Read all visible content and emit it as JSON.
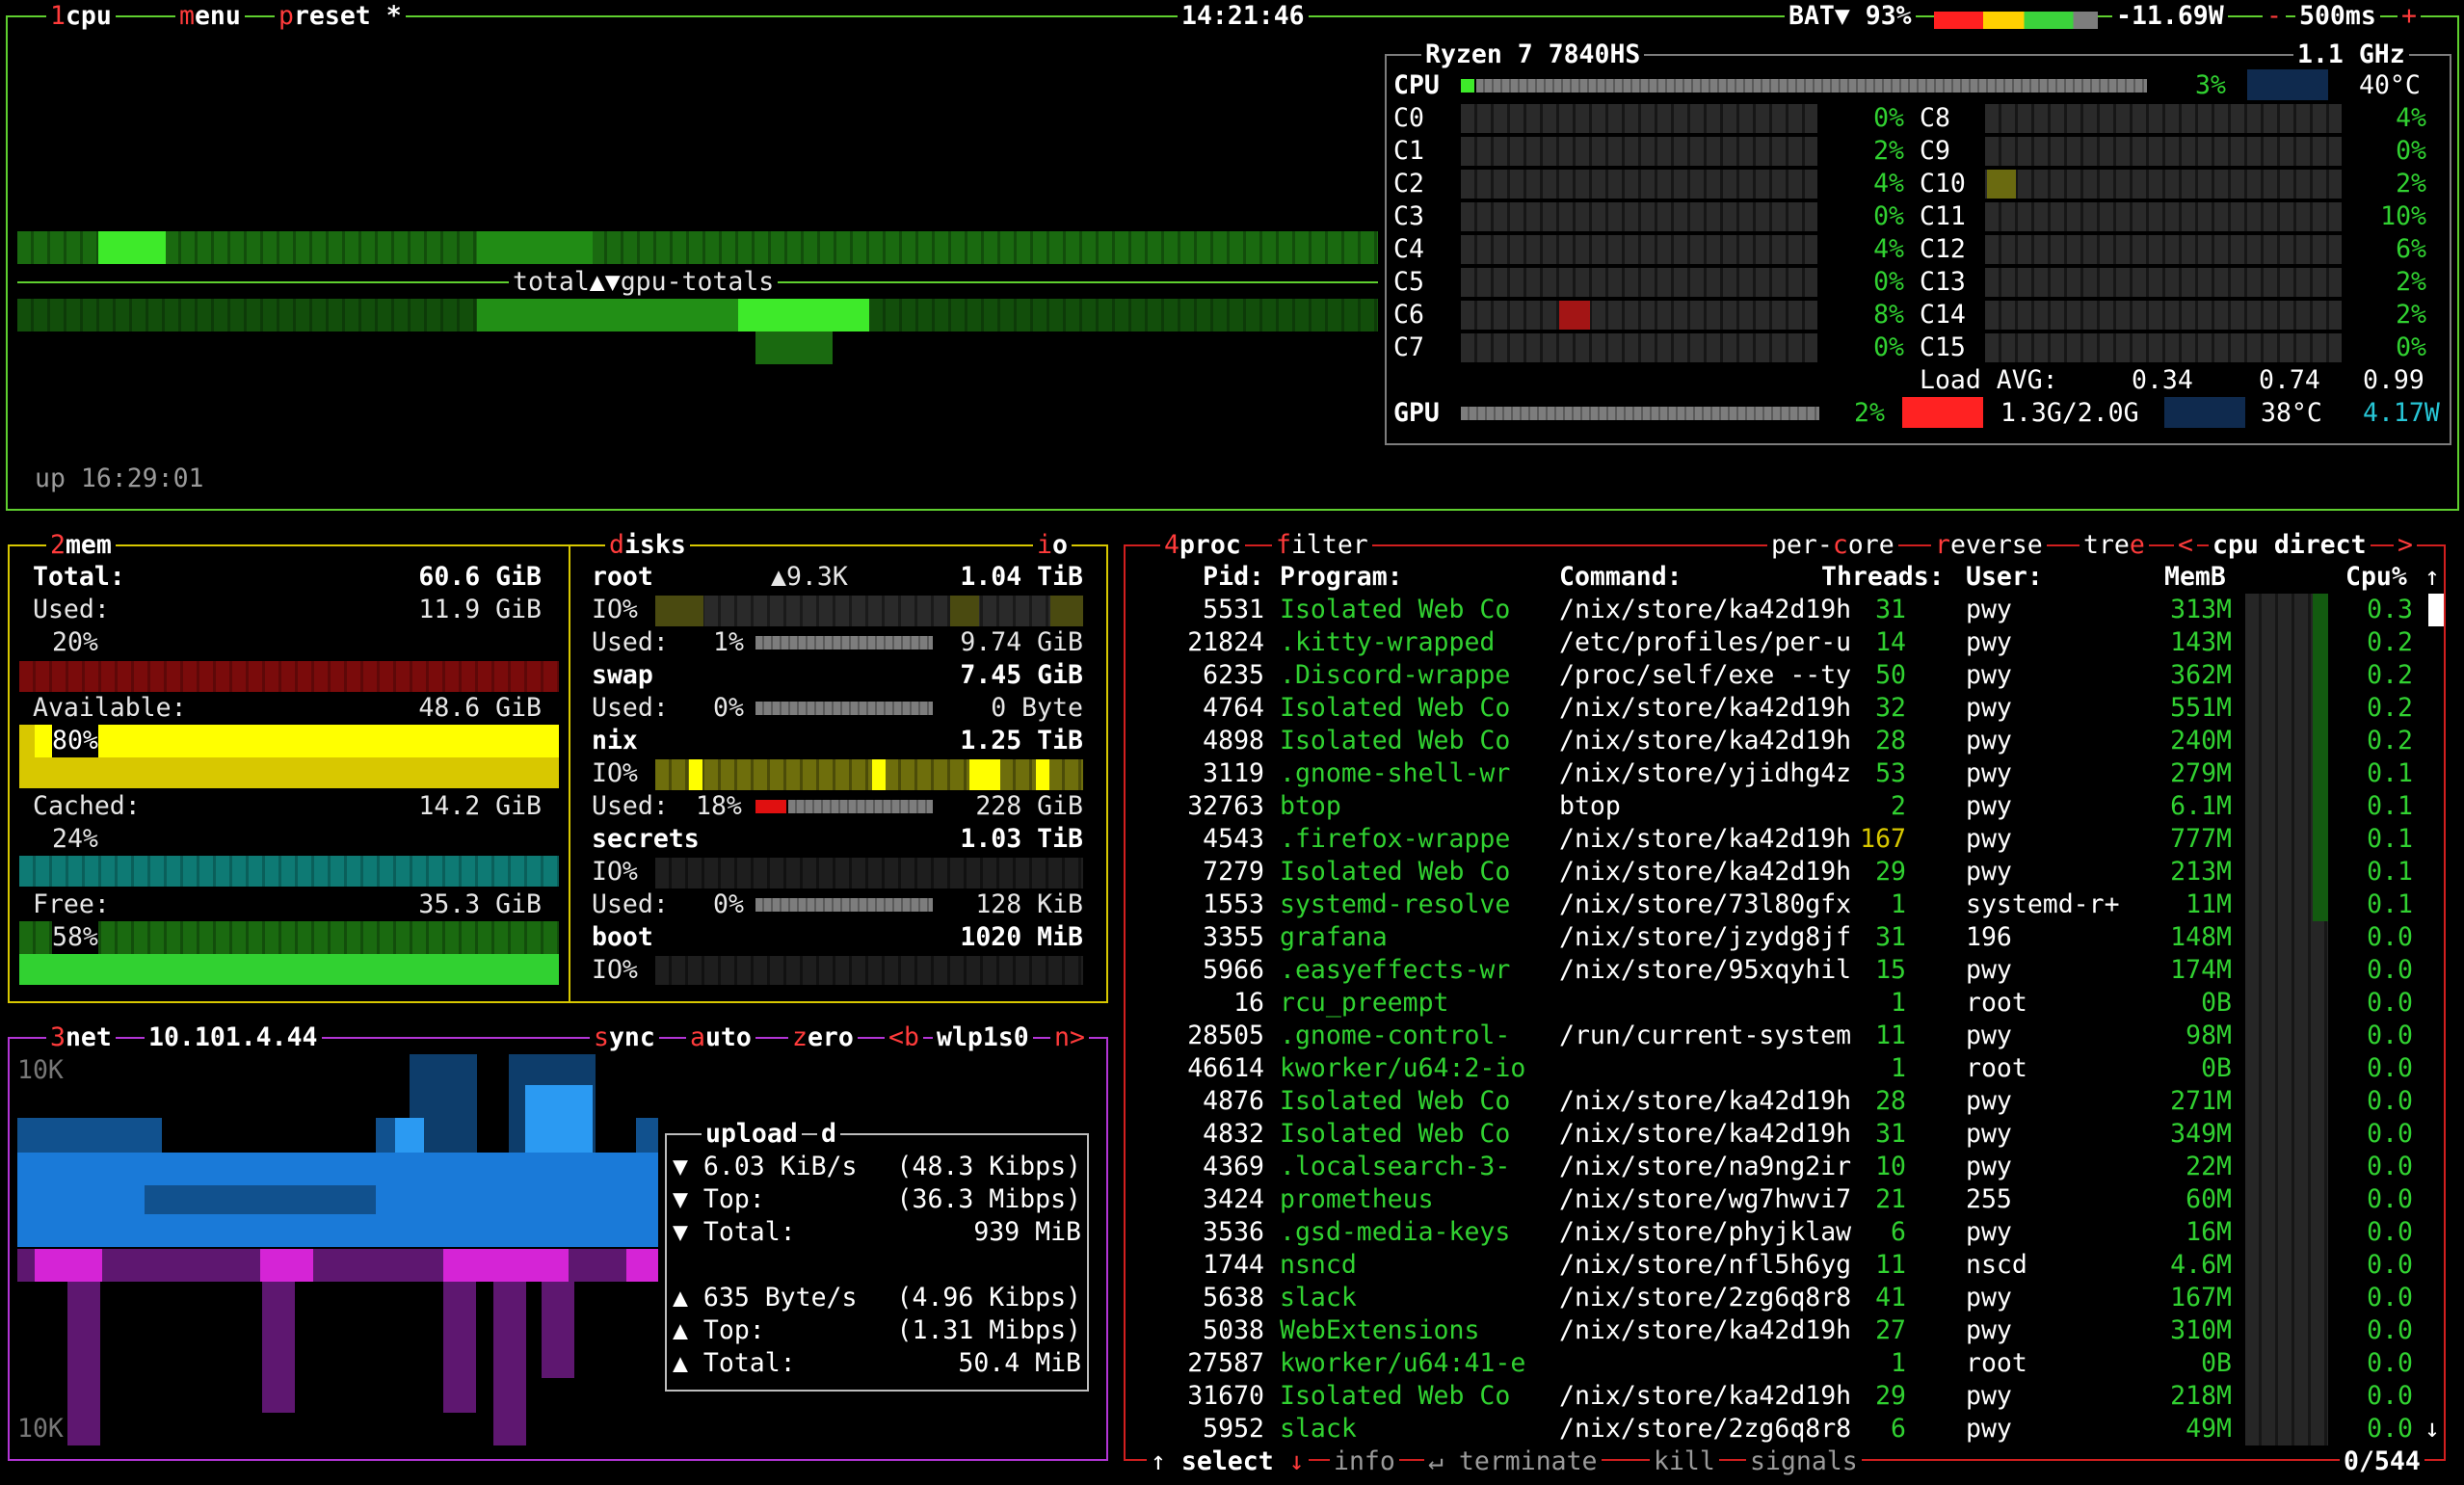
{
  "cpu_box": {
    "title_num": "1",
    "title": "cpu",
    "menu": "menu",
    "preset": "preset *",
    "clock": "14:21:46",
    "battery": "BAT▼ 93%",
    "power": "-11.69W",
    "minus": "-",
    "rate": "500ms",
    "plus": "+",
    "model": "Ryzen 7 7840HS",
    "freq": "1.1 GHz",
    "total_label": "total",
    "arrows": "▲▼",
    "gpu_label": "gpu-totals",
    "uptime": "up 16:29:01",
    "cpu_label": "CPU",
    "cpu_pct": "3%",
    "cpu_temp": "40°C",
    "cores_left": [
      {
        "name": "C0",
        "pct": "0%"
      },
      {
        "name": "C1",
        "pct": "2%"
      },
      {
        "name": "C2",
        "pct": "4%"
      },
      {
        "name": "C3",
        "pct": "0%"
      },
      {
        "name": "C4",
        "pct": "4%"
      },
      {
        "name": "C5",
        "pct": "0%"
      },
      {
        "name": "C6",
        "pct": "8%"
      },
      {
        "name": "C7",
        "pct": "0%"
      }
    ],
    "cores_right": [
      {
        "name": "C8",
        "pct": "4%"
      },
      {
        "name": "C9",
        "pct": "0%"
      },
      {
        "name": "C10",
        "pct": "2%"
      },
      {
        "name": "C11",
        "pct": "10%"
      },
      {
        "name": "C12",
        "pct": "6%"
      },
      {
        "name": "C13",
        "pct": "2%"
      },
      {
        "name": "C14",
        "pct": "2%"
      },
      {
        "name": "C15",
        "pct": "0%"
      }
    ],
    "load_label": "Load AVG:",
    "load": [
      "0.34",
      "0.74",
      "0.99"
    ],
    "gpu_name": "GPU",
    "gpu_pct": "2%",
    "gpu_mem": "1.3G/2.0G",
    "gpu_temp": "38°C",
    "gpu_power": "4.17W"
  },
  "mem": {
    "title_num": "2",
    "title": "mem",
    "total_label": "Total:",
    "total": "60.6 GiB",
    "used_label": "Used:",
    "used": "11.9 GiB",
    "used_pct": "20%",
    "avail_label": "Available:",
    "avail": "48.6 GiB",
    "avail_pct": "80%",
    "cached_label": "Cached:",
    "cached": "14.2 GiB",
    "cached_pct": "24%",
    "free_label": "Free:",
    "free": "35.3 GiB",
    "free_pct": "58%"
  },
  "disks": {
    "title": "disks",
    "io_tag": "io",
    "root": {
      "name": "root",
      "rate": "▲9.3K",
      "size": "1.04 TiB",
      "io": "IO%",
      "used_label": "Used:",
      "used_pct": "1%",
      "used": "9.74 GiB"
    },
    "swap": {
      "name": "swap",
      "size": "7.45 GiB",
      "used_label": "Used:",
      "used_pct": "0%",
      "used": "0 Byte"
    },
    "nix": {
      "name": "nix",
      "size": "1.25 TiB",
      "io": "IO%",
      "used_label": "Used:",
      "used_pct": "18%",
      "used": "228 GiB"
    },
    "secrets": {
      "name": "secrets",
      "size": "1.03 TiB",
      "io": "IO%",
      "used_label": "Used:",
      "used_pct": "0%",
      "used": "128 KiB"
    },
    "boot": {
      "name": "boot",
      "size": "1020 MiB",
      "io": "IO%"
    }
  },
  "net": {
    "title_num": "3",
    "title": "net",
    "ip": "10.101.4.44",
    "sync": "sync",
    "auto": "auto",
    "zero": "zero",
    "prev": "<b",
    "iface": "wlp1s0",
    "next": "n>",
    "scale_top": "10K",
    "scale_bottom": "10K",
    "upload_label": "upload",
    "d_label": "d",
    "down_rate": "▼ 6.03 KiB/s",
    "down_bits": "(48.3 Kibps)",
    "down_top_label": "▼ Top:",
    "down_top": "(36.3 Mibps)",
    "down_total_label": "▼ Total:",
    "down_total": "939 MiB",
    "up_rate": "▲ 635 Byte/s",
    "up_bits": "(4.96 Kibps)",
    "up_top_label": "▲ Top:",
    "up_top": "(1.31 Mibps)",
    "up_total_label": "▲ Total:",
    "up_total": "50.4 MiB"
  },
  "proc": {
    "title_num": "4",
    "title": "proc",
    "filter": "filter",
    "per_core": "per-core",
    "reverse": "reverse",
    "tree": "tree",
    "sort_left": "<",
    "sort": "cpu direct",
    "sort_right": ">",
    "headers": {
      "pid": "Pid:",
      "program": "Program:",
      "command": "Command:",
      "threads": "Threads:",
      "user": "User:",
      "mem": "MemB",
      "cpu": "Cpu%"
    },
    "rows": [
      [
        "5531",
        "Isolated Web Co",
        "/nix/store/ka42d19h",
        "31",
        "pwy",
        "313M",
        "0.3"
      ],
      [
        "21824",
        ".kitty-wrapped",
        "/etc/profiles/per-u",
        "14",
        "pwy",
        "143M",
        "0.2"
      ],
      [
        "6235",
        ".Discord-wrappe",
        "/proc/self/exe --ty",
        "50",
        "pwy",
        "362M",
        "0.2"
      ],
      [
        "4764",
        "Isolated Web Co",
        "/nix/store/ka42d19h",
        "32",
        "pwy",
        "551M",
        "0.2"
      ],
      [
        "4898",
        "Isolated Web Co",
        "/nix/store/ka42d19h",
        "28",
        "pwy",
        "240M",
        "0.2"
      ],
      [
        "3119",
        ".gnome-shell-wr",
        "/nix/store/yjidhg4z",
        "53",
        "pwy",
        "279M",
        "0.1"
      ],
      [
        "32763",
        "btop",
        "btop",
        "2",
        "pwy",
        "6.1M",
        "0.1"
      ],
      [
        "4543",
        ".firefox-wrappe",
        "/nix/store/ka42d19h",
        "167",
        "pwy",
        "777M",
        "0.1"
      ],
      [
        "7279",
        "Isolated Web Co",
        "/nix/store/ka42d19h",
        "29",
        "pwy",
        "213M",
        "0.1"
      ],
      [
        "1553",
        "systemd-resolve",
        "/nix/store/73l80gfx",
        "1",
        "systemd-r+",
        "11M",
        "0.1"
      ],
      [
        "3355",
        "grafana",
        "/nix/store/jzydg8jf",
        "31",
        "196",
        "148M",
        "0.0"
      ],
      [
        "5966",
        ".easyeffects-wr",
        "/nix/store/95xqyhil",
        "15",
        "pwy",
        "174M",
        "0.0"
      ],
      [
        "16",
        "rcu_preempt",
        "",
        "1",
        "root",
        "0B",
        "0.0"
      ],
      [
        "28505",
        ".gnome-control-",
        "/run/current-system",
        "11",
        "pwy",
        "98M",
        "0.0"
      ],
      [
        "46614",
        "kworker/u64:2-io",
        "",
        "1",
        "root",
        "0B",
        "0.0"
      ],
      [
        "4876",
        "Isolated Web Co",
        "/nix/store/ka42d19h",
        "28",
        "pwy",
        "271M",
        "0.0"
      ],
      [
        "4832",
        "Isolated Web Co",
        "/nix/store/ka42d19h",
        "31",
        "pwy",
        "349M",
        "0.0"
      ],
      [
        "4369",
        ".localsearch-3-",
        "/nix/store/na9ng2ir",
        "10",
        "pwy",
        "22M",
        "0.0"
      ],
      [
        "3424",
        "prometheus",
        "/nix/store/wg7hwvi7",
        "21",
        "255",
        "60M",
        "0.0"
      ],
      [
        "3536",
        ".gsd-media-keys",
        "/nix/store/phyjklaw",
        "6",
        "pwy",
        "16M",
        "0.0"
      ],
      [
        "1744",
        "nsncd",
        "/nix/store/nfl5h6yg",
        "11",
        "nscd",
        "4.6M",
        "0.0"
      ],
      [
        "5638",
        "slack",
        "/nix/store/2zg6q8r8",
        "41",
        "pwy",
        "167M",
        "0.0"
      ],
      [
        "5038",
        "WebExtensions",
        "/nix/store/ka42d19h",
        "27",
        "pwy",
        "310M",
        "0.0"
      ],
      [
        "27587",
        "kworker/u64:41-e",
        "",
        "1",
        "root",
        "0B",
        "0.0"
      ],
      [
        "31670",
        "Isolated Web Co",
        "/nix/store/ka42d19h",
        "29",
        "pwy",
        "218M",
        "0.0"
      ],
      [
        "5952",
        "slack",
        "/nix/store/2zg6q8r8",
        "6",
        "pwy",
        "49M",
        "0.0"
      ]
    ],
    "footer": {
      "select": "↑ select ↓",
      "info": "info",
      "terminate": "terminate",
      "kill": "kill",
      "signals": "signals",
      "count": "0/544"
    }
  },
  "colors": {
    "cpu_border": "#5fcf2f",
    "mem_border": "#d8c800",
    "net_border": "#b335d6",
    "proc_border": "#d21f1f",
    "highlight": "#ff3b3b",
    "green": "#31d131"
  }
}
